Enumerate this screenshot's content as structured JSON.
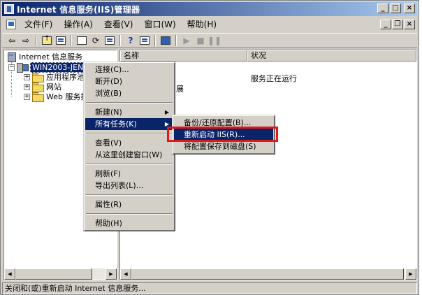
{
  "window": {
    "title": "Internet 信息服务(IIS)管理器",
    "buttons": {
      "minimize": "_",
      "maximize": "□",
      "close": "×"
    }
  },
  "menubar": {
    "items": [
      "文件(F)",
      "操作(A)",
      "查看(V)",
      "窗口(W)",
      "帮助(H)"
    ],
    "buttons": {
      "minimize": "_",
      "restore": "❐",
      "close": "×"
    }
  },
  "toolbar": {
    "icons": [
      "back-icon",
      "forward-icon",
      "up-folder-icon",
      "show-tree-icon",
      "properties-icon",
      "refresh-icon",
      "export-list-icon",
      "help-icon",
      "console-icon",
      "computer-icon",
      "start-icon",
      "stop-icon",
      "pause-icon"
    ]
  },
  "tree": {
    "root": "Internet 信息服务",
    "server": "WIN2003-JENRY",
    "children": [
      "应用程序池",
      "网站",
      "Web 服务扩展"
    ]
  },
  "list": {
    "columns": [
      "名称",
      "状况"
    ],
    "status_text": "服务正在运行",
    "partial_name": "应用程序池",
    "partial_fragment": "展"
  },
  "context_menu": {
    "items": [
      "连接(C)...",
      "断开(D)",
      "浏览(B)",
      "新建(N)",
      "所有任务(K)",
      "查看(V)",
      "从这里创建窗口(W)",
      "刷新(F)",
      "导出列表(L)...",
      "属性(R)",
      "帮助(H)"
    ]
  },
  "submenu": {
    "items": [
      "备份/还原配置(B)...",
      "重新启动 IIS(R)...",
      "将配置保存到磁盘(S)"
    ]
  },
  "statusbar": {
    "text": "关闭和(或)重新启动 Internet 信息服务..."
  },
  "colors": {
    "title_active": "#0a246a",
    "title_gradient_end": "#a6caf0",
    "highlight_box": "#e01818",
    "face": "#d4d0c8"
  }
}
